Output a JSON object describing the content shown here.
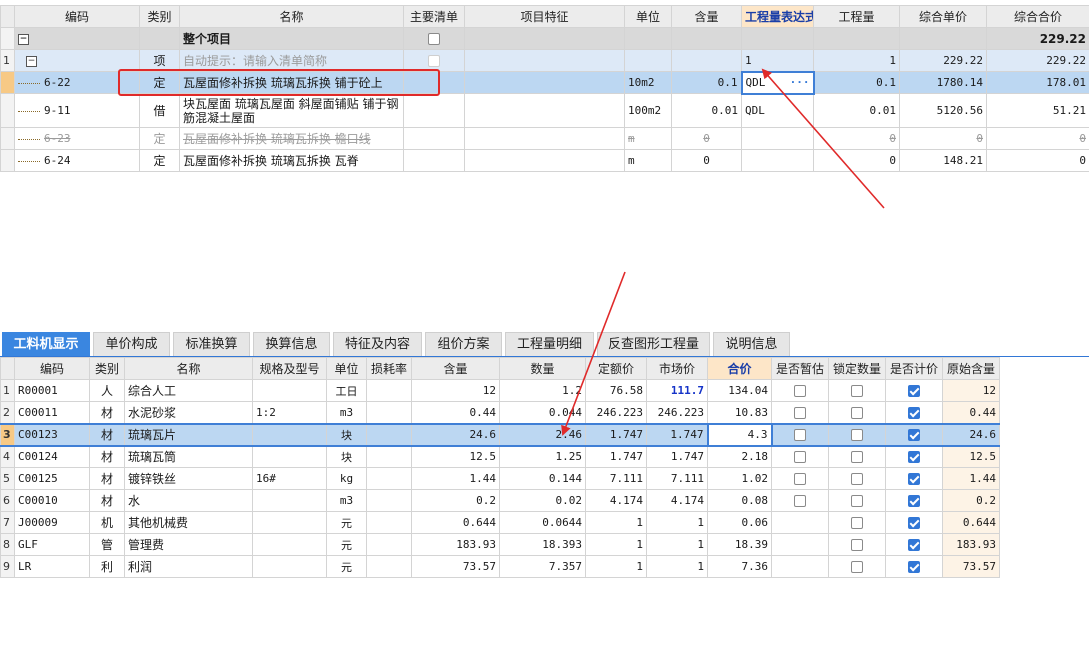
{
  "top_table": {
    "headers": [
      "编码",
      "类别",
      "名称",
      "主要清单",
      "项目特征",
      "单位",
      "含量",
      "工程量表达式",
      "工程量",
      "综合单价",
      "综合合价"
    ],
    "whole_row": {
      "label": "整个项目",
      "total": "229.22"
    },
    "item_row": {
      "rownum": "1",
      "type": "项",
      "name": "自动提示：请输入清单简称",
      "expr": "1",
      "qty": "1",
      "unit_price": "229.22",
      "total": "229.22"
    },
    "rows": [
      {
        "code": "6-22",
        "type": "定",
        "name": "瓦屋面修补拆换 琉璃瓦拆换 铺于砼上",
        "unit": "10m2",
        "content": "0.1",
        "expr": "QDL",
        "qty": "0.1",
        "unit_price": "1780.14",
        "total": "178.01"
      },
      {
        "code": "9-11",
        "type": "借",
        "name": "块瓦屋面 琉璃瓦屋面 斜屋面铺贴 铺于钢筋混凝土屋面",
        "unit": "100m2",
        "content": "0.01",
        "expr": "QDL",
        "qty": "0.01",
        "unit_price": "5120.56",
        "total": "51.21"
      },
      {
        "code": "6-23",
        "type": "定",
        "name": "瓦屋面修补拆换 琉璃瓦拆换 檐口线",
        "unit": "m",
        "content": "0",
        "expr": "",
        "qty": "0",
        "unit_price": "0",
        "total": "0"
      },
      {
        "code": "6-24",
        "type": "定",
        "name": "瓦屋面修补拆换 琉璃瓦拆换 瓦脊",
        "unit": "m",
        "content": "0",
        "expr": "",
        "qty": "0",
        "unit_price": "148.21",
        "total": "0"
      }
    ],
    "ellipsis": "···"
  },
  "tabs": [
    "工料机显示",
    "单价构成",
    "标准换算",
    "换算信息",
    "特征及内容",
    "组价方案",
    "工程量明细",
    "反查图形工程量",
    "说明信息"
  ],
  "bottom_table": {
    "headers": [
      "编码",
      "类别",
      "名称",
      "规格及型号",
      "单位",
      "损耗率",
      "含量",
      "数量",
      "定额价",
      "市场价",
      "合价",
      "是否暂估",
      "锁定数量",
      "是否计价",
      "原始含量"
    ],
    "rows": [
      {
        "n": "1",
        "code": "R00001",
        "type": "人",
        "name": "综合人工",
        "spec": "",
        "unit": "工日",
        "content": "12",
        "qty": "1.2",
        "quota": "76.58",
        "market": "111.7",
        "total": "134.04",
        "temp": false,
        "lock": false,
        "price": true,
        "orig": "12"
      },
      {
        "n": "2",
        "code": "C00011",
        "type": "材",
        "name": "水泥砂浆",
        "spec": "1:2",
        "unit": "m3",
        "content": "0.44",
        "qty": "0.044",
        "quota": "246.223",
        "market": "246.223",
        "total": "10.83",
        "temp": false,
        "lock": false,
        "price": true,
        "orig": "0.44"
      },
      {
        "n": "3",
        "code": "C00123",
        "type": "材",
        "name": "琉璃瓦片",
        "spec": "",
        "unit": "块",
        "content": "24.6",
        "qty": "2.46",
        "quota": "1.747",
        "market": "1.747",
        "total": "4.3",
        "temp": false,
        "lock": false,
        "price": true,
        "orig": "24.6"
      },
      {
        "n": "4",
        "code": "C00124",
        "type": "材",
        "name": "琉璃瓦筒",
        "spec": "",
        "unit": "块",
        "content": "12.5",
        "qty": "1.25",
        "quota": "1.747",
        "market": "1.747",
        "total": "2.18",
        "temp": false,
        "lock": false,
        "price": true,
        "orig": "12.5"
      },
      {
        "n": "5",
        "code": "C00125",
        "type": "材",
        "name": "镀锌铁丝",
        "spec": "16#",
        "unit": "kg",
        "content": "1.44",
        "qty": "0.144",
        "quota": "7.111",
        "market": "7.111",
        "total": "1.02",
        "temp": false,
        "lock": false,
        "price": true,
        "orig": "1.44"
      },
      {
        "n": "6",
        "code": "C00010",
        "type": "材",
        "name": "水",
        "spec": "",
        "unit": "m3",
        "content": "0.2",
        "qty": "0.02",
        "quota": "4.174",
        "market": "4.174",
        "total": "0.08",
        "temp": false,
        "lock": false,
        "price": true,
        "orig": "0.2"
      },
      {
        "n": "7",
        "code": "J00009",
        "type": "机",
        "name": "其他机械费",
        "spec": "",
        "unit": "元",
        "content": "0.644",
        "qty": "0.0644",
        "quota": "1",
        "market": "1",
        "total": "0.06",
        "temp": null,
        "lock": false,
        "price": true,
        "orig": "0.644"
      },
      {
        "n": "8",
        "code": "GLF",
        "type": "管",
        "name": "管理费",
        "spec": "",
        "unit": "元",
        "content": "183.93",
        "qty": "18.393",
        "quota": "1",
        "market": "1",
        "total": "18.39",
        "temp": null,
        "lock": false,
        "price": true,
        "orig": "183.93"
      },
      {
        "n": "9",
        "code": "LR",
        "type": "利",
        "name": "利润",
        "spec": "",
        "unit": "元",
        "content": "73.57",
        "qty": "7.357",
        "quota": "1",
        "market": "1",
        "total": "7.36",
        "temp": null,
        "lock": false,
        "price": true,
        "orig": "73.57"
      }
    ]
  },
  "colors": {
    "accent": "#3a86e0",
    "annotation": "#e02a2a",
    "selection": "#bcd7f2"
  }
}
